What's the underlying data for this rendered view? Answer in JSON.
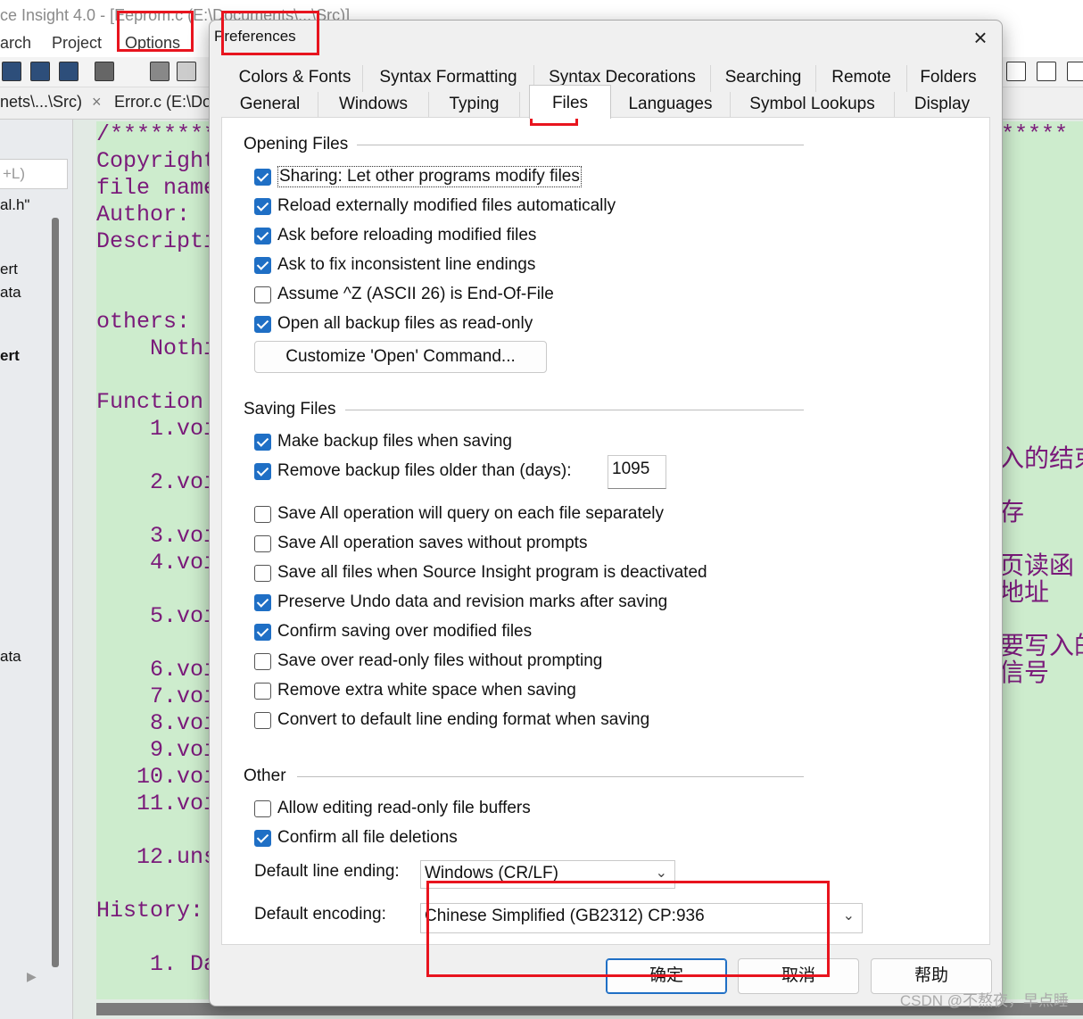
{
  "background": {
    "title": "ce Insight 4.0 - [Eeprom.c (E:\\Documents\\...\\Src)]",
    "menu": [
      "arch",
      "Project",
      "Options"
    ],
    "file_tabs": [
      {
        "label": "nets\\...\\Src)",
        "close": "×"
      },
      {
        "label": "Error.c (E:\\Do"
      }
    ],
    "sidebar": {
      "search_hint": "+L)",
      "lines": [
        "al.h\"",
        "ert",
        "ata",
        "ert",
        "ata"
      ],
      "bold_line": "ert"
    },
    "code_lines": [
      "/*********",
      "Copyright",
      "file name",
      "Author:",
      "Descripti",
      "others:",
      "    Nothi",
      "Function",
      "    1.voi",
      "    2.voi",
      "    3.voi",
      "    4.voi",
      "    5.voi",
      "    6.voi",
      "    7.voi",
      "    8.voi",
      "    9.voi",
      "   10.voi",
      "   11.voi",
      "   12.uns",
      "History:",
      "    1. Da"
    ],
    "code_right_stars": "*****",
    "cn_fragments": [
      "入的结束",
      "存",
      "页读函",
      "地址",
      "要写入的",
      "信号"
    ],
    "watermark": "CSDN @不熬夜，早点睡"
  },
  "dialog": {
    "title": "Preferences",
    "close_icon": "×",
    "tabs_row1": [
      "Colors & Fonts",
      "Syntax Formatting",
      "Syntax Decorations",
      "Searching",
      "Remote",
      "Folders"
    ],
    "tabs_row2": [
      "General",
      "Windows",
      "Typing",
      "Files",
      "Languages",
      "Symbol Lookups",
      "Display"
    ],
    "active_tab": "Files",
    "opening_files": {
      "title": "Opening Files",
      "options": [
        {
          "label": "Sharing: Let other programs modify files",
          "checked": true
        },
        {
          "label": "Reload externally modified files automatically",
          "checked": true
        },
        {
          "label": "Ask before reloading modified files",
          "checked": true
        },
        {
          "label": "Ask to fix inconsistent line endings",
          "checked": true
        },
        {
          "label": "Assume ^Z (ASCII 26) is End-Of-File",
          "checked": false
        },
        {
          "label": "Open all backup files as read-only",
          "checked": true
        }
      ],
      "customize_button": "Customize 'Open' Command..."
    },
    "saving_files": {
      "title": "Saving Files",
      "options": [
        {
          "label": "Make backup files when saving",
          "checked": true
        },
        {
          "label": "Remove backup files older than (days):",
          "checked": true
        },
        {
          "label": "Save All operation will query on each file separately",
          "checked": false
        },
        {
          "label": "Save All operation saves without prompts",
          "checked": false
        },
        {
          "label": "Save all files when Source Insight program is deactivated",
          "checked": false
        },
        {
          "label": "Preserve Undo data and revision marks after saving",
          "checked": true
        },
        {
          "label": "Confirm saving over modified files",
          "checked": true
        },
        {
          "label": "Save over read-only files without prompting",
          "checked": false
        },
        {
          "label": "Remove extra white space when saving",
          "checked": false
        },
        {
          "label": "Convert to default line ending format when saving",
          "checked": false
        }
      ],
      "days_value": "1095"
    },
    "other": {
      "title": "Other",
      "options": [
        {
          "label": "Allow editing read-only file buffers",
          "checked": false
        },
        {
          "label": "Confirm all file deletions",
          "checked": true
        }
      ],
      "line_ending_label": "Default line ending:",
      "line_ending_value": "Windows (CR/LF)",
      "encoding_label": "Default encoding:",
      "encoding_value": "Chinese Simplified (GB2312)  CP:936"
    },
    "buttons": {
      "ok": "确定",
      "cancel": "取消",
      "help": "帮助"
    }
  },
  "colors": {
    "highlight_box": "#e8141e",
    "checkbox_accent": "#1f6fc5",
    "code_bg": "#cdeccd",
    "code_text": "#7a1a7a"
  }
}
